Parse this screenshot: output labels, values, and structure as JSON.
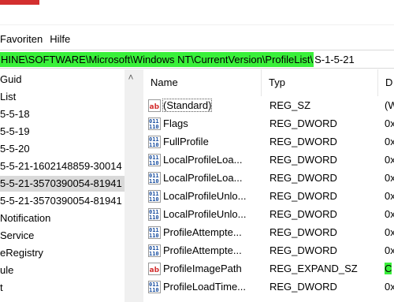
{
  "menu": {
    "items": [
      "Favoriten",
      "Hilfe"
    ]
  },
  "address": {
    "highlighted": "HINE\\SOFTWARE\\Microsoft\\Windows NT\\CurrentVersion\\ProfileList\\",
    "rest": "S-1-5-21"
  },
  "tree": {
    "items": [
      {
        "label": "Guid"
      },
      {
        "label": "List"
      },
      {
        "label": "5-5-18"
      },
      {
        "label": "5-5-19"
      },
      {
        "label": "5-5-20"
      },
      {
        "label": "5-5-21-1602148859-30014"
      },
      {
        "label": "5-5-21-3570390054-81941"
      },
      {
        "label": "5-5-21-3570390054-81941"
      },
      {
        "label": "Notification"
      },
      {
        "label": "Service"
      },
      {
        "label": "eRegistry"
      },
      {
        "label": "ule"
      },
      {
        "label": "t"
      }
    ]
  },
  "list": {
    "columns": {
      "name": "Name",
      "type": "Typ",
      "data": "D"
    },
    "rows": [
      {
        "name": "(Standard)",
        "type": "REG_SZ",
        "data": "(W",
        "icon": "string-value-icon"
      },
      {
        "name": "Flags",
        "type": "REG_DWORD",
        "data": "0x",
        "icon": "binary-value-icon"
      },
      {
        "name": "FullProfile",
        "type": "REG_DWORD",
        "data": "0x",
        "icon": "binary-value-icon"
      },
      {
        "name": "LocalProfileLoa...",
        "type": "REG_DWORD",
        "data": "0x",
        "icon": "binary-value-icon"
      },
      {
        "name": "LocalProfileLoa...",
        "type": "REG_DWORD",
        "data": "0x",
        "icon": "binary-value-icon"
      },
      {
        "name": "LocalProfileUnlo...",
        "type": "REG_DWORD",
        "data": "0x",
        "icon": "binary-value-icon"
      },
      {
        "name": "LocalProfileUnlo...",
        "type": "REG_DWORD",
        "data": "0x",
        "icon": "binary-value-icon"
      },
      {
        "name": "ProfileAttempte...",
        "type": "REG_DWORD",
        "data": "0x",
        "icon": "binary-value-icon"
      },
      {
        "name": "ProfileAttempte...",
        "type": "REG_DWORD",
        "data": "0x",
        "icon": "binary-value-icon"
      },
      {
        "name": "ProfileImagePath",
        "type": "REG_EXPAND_SZ",
        "data": "C",
        "icon": "string-value-icon"
      },
      {
        "name": "ProfileLoadTime...",
        "type": "REG_DWORD",
        "data": "0x",
        "icon": "binary-value-icon"
      }
    ]
  },
  "colors": {
    "highlight": "#39f03a",
    "selection": "#d9d9d9",
    "accent": "#d32f2f"
  }
}
